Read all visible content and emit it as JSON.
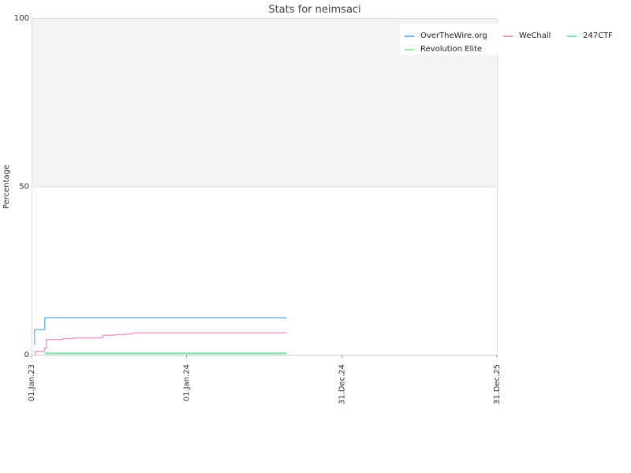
{
  "chart_data": {
    "type": "line",
    "title": "Stats for neimsaci",
    "xlabel": "",
    "ylabel": "Percentage",
    "ylim": [
      0,
      100
    ],
    "xlim": [
      "2023-01-01",
      "2025-12-31"
    ],
    "x_ticks": [
      "01.Jan.23",
      "01.Jan.24",
      "31.Dec.24",
      "31.Dec.25"
    ],
    "y_ticks": [
      0,
      50,
      100
    ],
    "grid": true,
    "upper_band_color": "#f3f3f3",
    "legend_position": "top-right",
    "series": [
      {
        "name": "OverTheWire.org",
        "color": "#7ab8e8",
        "points": [
          [
            "2023-01-08",
            3.0
          ],
          [
            "2023-01-08",
            7.5
          ],
          [
            "2023-02-01",
            8.5
          ],
          [
            "2023-02-01",
            11.0
          ],
          [
            "2024-08-23",
            11.0
          ]
        ]
      },
      {
        "name": "WeChall",
        "color": "#f0a0c8",
        "points": [
          [
            "2023-01-08",
            0.0
          ],
          [
            "2023-01-10",
            1.0
          ],
          [
            "2023-01-30",
            1.2
          ],
          [
            "2023-02-01",
            2.0
          ],
          [
            "2023-02-05",
            4.5
          ],
          [
            "2023-03-15",
            4.8
          ],
          [
            "2023-04-10",
            5.0
          ],
          [
            "2023-06-15",
            5.2
          ],
          [
            "2023-06-18",
            5.8
          ],
          [
            "2023-07-15",
            6.0
          ],
          [
            "2023-08-10",
            6.2
          ],
          [
            "2023-08-28",
            6.5
          ],
          [
            "2024-08-23",
            6.5
          ]
        ]
      },
      {
        "name": "247CTF",
        "color": "#80e0c0",
        "points": [
          [
            "2023-02-01",
            0.5
          ],
          [
            "2024-08-23",
            0.5
          ]
        ]
      },
      {
        "name": "Revolution Elite",
        "color": "#98e898",
        "points": [
          [
            "2023-02-01",
            0.3
          ],
          [
            "2024-08-23",
            0.3
          ]
        ]
      }
    ]
  }
}
